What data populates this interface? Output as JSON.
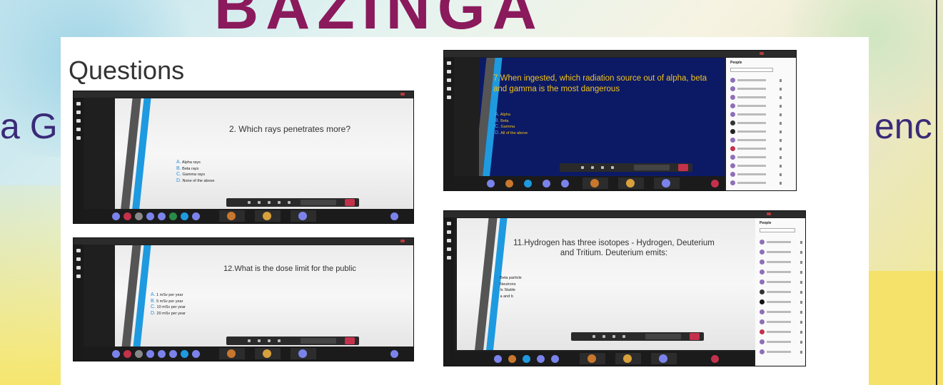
{
  "background": {
    "banner_title": "BAZINGA",
    "side_left_text": "a G",
    "side_right_text": "enc"
  },
  "slide": {
    "heading": "Questions"
  },
  "windows": [
    {
      "question": "2. Which rays penetrates more?",
      "options": [
        {
          "letter": "A.",
          "text": "Alpha rays"
        },
        {
          "letter": "B.",
          "text": "Beta rays"
        },
        {
          "letter": "C.",
          "text": "Gamma rays"
        },
        {
          "letter": "D.",
          "text": "None of the above"
        }
      ],
      "leave_label": "Leave",
      "hangup_icon": "phone-hangup-icon"
    },
    {
      "question": "7.When ingested, which radiation source out of alpha, beta and gamma is the most dangerous",
      "options": [
        {
          "letter": "A.",
          "text": "Alpha"
        },
        {
          "letter": "B.",
          "text": "Beta"
        },
        {
          "letter": "C.",
          "text": "Gamma"
        },
        {
          "letter": "D.",
          "text": "All of the above"
        }
      ],
      "people_title": "People",
      "leave_label": "Leave"
    },
    {
      "question": "12.What is the dose limit for the public",
      "options": [
        {
          "letter": "A.",
          "text": "1 mSv per year"
        },
        {
          "letter": "B.",
          "text": "5 mSv per year"
        },
        {
          "letter": "C.",
          "text": "10 mSv per year"
        },
        {
          "letter": "D.",
          "text": "20 mSv per year"
        }
      ],
      "leave_label": "Leave"
    },
    {
      "question": "11.Hydrogen has three isotopes - Hydrogen, Deuterium and Tritium. Deuterium emits:",
      "options": [
        {
          "letter": "A.",
          "text": "Beta particle"
        },
        {
          "letter": "B.",
          "text": "Neutrons"
        },
        {
          "letter": "C.",
          "text": "Is Stable"
        },
        {
          "letter": "D.",
          "text": "a and b"
        }
      ],
      "people_title": "People",
      "leave_label": "Leave"
    }
  ],
  "colors": {
    "accent_blue": "#1e9ae0",
    "teams_purple": "#7b83eb",
    "hangup_red": "#c4314b",
    "question_gold": "#f2c21b",
    "banner_magenta": "#8a1a5c"
  }
}
